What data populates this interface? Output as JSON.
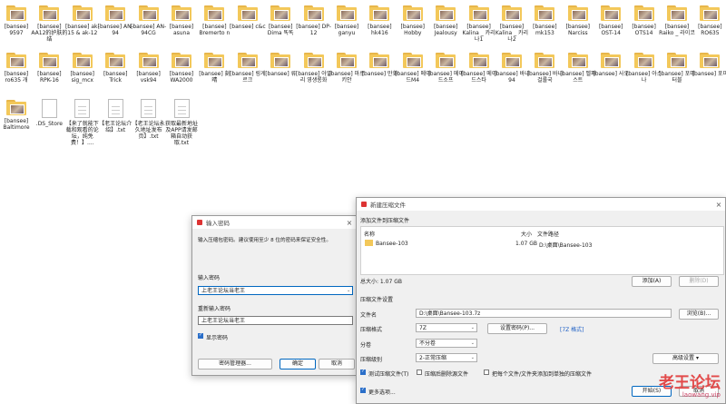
{
  "desktop": {
    "row1": [
      "[bansee] 9597",
      "[bansee] AA12的护肤的结",
      "[bansee] ak-15 & ak-12",
      "[bansee] AN-94",
      "[bansee] AN-94CG",
      "[bansee] asuna",
      "[bansee] Bremerto n",
      "[bansee] c&c",
      "[bansee] Dima 똑똑",
      "[bansee] DP-12",
      "[bansee] ganyu",
      "[bansee] hk416",
      "[bansee] Hobby",
      "[bansee] Jealousy",
      "[bansee] Kalina _ 카리나1",
      "[bansee] Kalina _ 카리나2",
      "[bansee] mk153",
      "[bansee] Narciss",
      "[bansee] OST-14",
      "[bansee] OTS14",
      "[bansee] Raiko _ 라이코",
      "[bansee] RO635"
    ],
    "row2": [
      "[bansee] ro635 개",
      "[bansee] RPK-16",
      "[bansee] sig_mcx",
      "[bansee] Trick",
      "[bansee] vsk94",
      "[bansee] WA2000",
      "[bansee] 刻晴",
      "[bansee] 링게르크",
      "[bansee] 류",
      "[bansee] 아일리 영생롱화",
      "[bansee] 마르키안",
      "[bansee] 만화",
      "[bansee] 메이드M4",
      "[bansee] 메이드소프",
      "[bansee] 메이드스타",
      "[bansee] 바니94",
      "[bansee] 바니걸롤국",
      "[bansee] 벨파스트",
      "[bansee] 사오",
      "[bansee] 아스나",
      "[bansee] 포미터블",
      "[bansee] 포미"
    ],
    "row3": [
      {
        "label": "[bansee] Baltimore",
        "kind": "folder"
      },
      {
        "label": ".DS_Store",
        "kind": "blank"
      },
      {
        "label": "【来了就能下载和观看的论坛，纯免费！】....",
        "kind": "doc"
      },
      {
        "label": "【老王论坛介绍】.txt",
        "kind": "doc"
      },
      {
        "label": "【老王论坛永久地址发布页】.txt",
        "kind": "doc"
      },
      {
        "label": "获取最新地址及APP请发邮箱自动获取.txt",
        "kind": "doc"
      }
    ]
  },
  "pwd_dialog": {
    "title": "输入密码",
    "hint": "输入压缩包密码。建议使用至少 8 位的密码来保证安全性。",
    "enter_label": "输入密码",
    "enter_value": "上老王论坛当老王",
    "reenter_label": "重新输入密码",
    "reenter_value": "上老王论坛当老王",
    "show_pwd": "显示密码",
    "manager_btn": "密码管理器...",
    "ok_btn": "确定",
    "cancel_btn": "取消"
  },
  "archive_dialog": {
    "title": "新建压缩文件",
    "add_label": "添加文件到压缩文件",
    "col_name": "名称",
    "col_size": "大小",
    "col_path": "文件路径",
    "file_name": "Bansee-103",
    "file_size": "1.07 GB",
    "file_path": "D:\\桌面\\Bansee-103",
    "total": "总大小: 1.07 GB",
    "add_btn": "添加(A)",
    "del_btn": "删除(D)",
    "settings_label": "压缩文件设置",
    "filename_label": "文件名",
    "filename_value": "D:\\桌面\\Bansee-103.7z",
    "browse_btn": "浏览(B)...",
    "format_label": "压缩格式",
    "format_value": "7Z",
    "setpwd_btn": "设置密码(P)...",
    "format_note": "[7Z 格式]",
    "split_label": "分卷",
    "split_value": "不分卷",
    "level_label": "压缩级别",
    "level_value": "2-正常压缩",
    "adv_btn": "高级设置 ▾",
    "opt1": "测试压缩文件(T)",
    "opt2": "压缩后删除源文件",
    "opt3": "把每个文件/文件夹添加到单独的压缩文件",
    "more": "更多选项...",
    "start_btn": "开始(S)",
    "cancel_btn": "取消"
  },
  "watermark": {
    "main": "老王论坛",
    "sub": "laowang.vip"
  }
}
